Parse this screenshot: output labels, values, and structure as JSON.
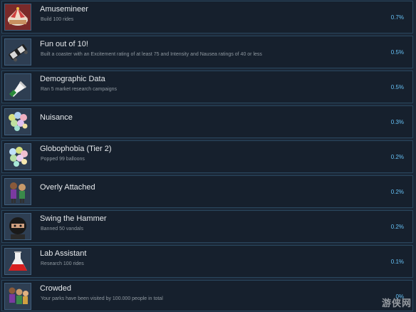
{
  "achievements": [
    {
      "title": "Amusemineer",
      "description": "Build 100 rides",
      "percent": "0.7%",
      "icon": "carousel-icon"
    },
    {
      "title": "Fun out of 10!",
      "description": "Built a coaster with an Excitement rating of at least 75 and Intensity and Nausea ratings of 40 or less",
      "percent": "0.5%",
      "icon": "coaster-car-icon"
    },
    {
      "title": "Demographic Data",
      "description": "Ran 5 market research campaigns",
      "percent": "0.5%",
      "icon": "megaphone-icon"
    },
    {
      "title": "Nuisance",
      "description": "",
      "percent": "0.3%",
      "icon": "balloons-icon"
    },
    {
      "title": "Globophobia (Tier 2)",
      "description": "Popped 99 balloons",
      "percent": "0.2%",
      "icon": "balloons-icon"
    },
    {
      "title": "Overly Attached",
      "description": "",
      "percent": "0.2%",
      "icon": "guests-icon"
    },
    {
      "title": "Swing the Hammer",
      "description": "Banned 50 vandals",
      "percent": "0.2%",
      "icon": "vandal-icon"
    },
    {
      "title": "Lab Assistant",
      "description": "Research 100 rides",
      "percent": "0.1%",
      "icon": "flask-icon"
    },
    {
      "title": "Crowded",
      "description": "Your parks have been visited by 100.000 people in total",
      "percent": "0%",
      "icon": "crowd-icon"
    }
  ],
  "watermark": "游侠网"
}
